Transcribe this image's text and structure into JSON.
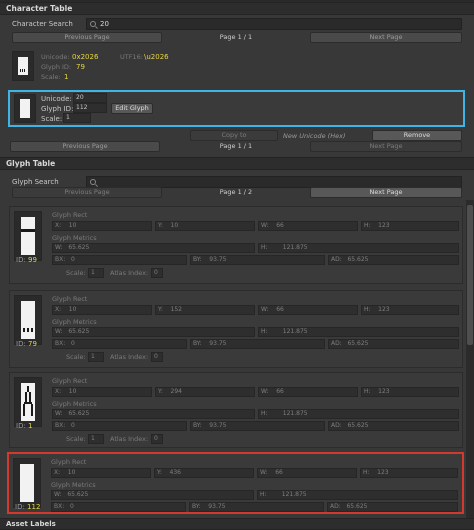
{
  "character_table": {
    "header": "Character Table",
    "search_label": "Character Search",
    "search_value": "20",
    "prev_label": "Previous Page",
    "next_label": "Next Page",
    "page_indicator": "Page 1 / 1",
    "item1": {
      "unicode_label": "Unicode:",
      "unicode_value": "0x2026",
      "utf16_label": "UTF16:",
      "utf16_value": "\\u2026",
      "glyph_id_label": "Glyph ID:",
      "glyph_id_value": "79",
      "scale_label": "Scale:",
      "scale_value": "1"
    },
    "item2": {
      "unicode_label": "Unicode:",
      "unicode_value": "20",
      "glyph_id_label": "Glyph ID:",
      "glyph_id_value": "112",
      "edit_glyph_label": "Edit Glyph",
      "scale_label": "Scale:",
      "scale_value": "1"
    },
    "copy_to_label": "Copy to",
    "new_unicode_label": "New Unicode (Hex)",
    "remove_label": "Remove",
    "page_indicator_2": "Page 1 / 1"
  },
  "glyph_table": {
    "header": "Glyph Table",
    "search_label": "Glyph Search",
    "prev_label": "Previous Page",
    "next_label": "Next Page",
    "page_indicator": "Page 1 / 2",
    "labels": {
      "glyph_rect": "Glyph Rect",
      "glyph_metrics": "Glyph Metrics",
      "x": "X:",
      "y": "Y:",
      "w": "W:",
      "h": "H:",
      "bx": "BX:",
      "by": "BY:",
      "ad": "AD:",
      "id": "ID:",
      "scale": "Scale:",
      "atlas_index": "Atlas Index:"
    },
    "records": [
      {
        "id": "99",
        "x": "10",
        "y": "10",
        "w": "66",
        "h": "123",
        "mw": "65.625",
        "mh": "121.875",
        "bx": "0",
        "by": "93.75",
        "ad": "65.625",
        "scale": "1",
        "atlas": "0"
      },
      {
        "id": "79",
        "x": "10",
        "y": "152",
        "w": "66",
        "h": "123",
        "mw": "65.625",
        "mh": "121.875",
        "bx": "0",
        "by": "93.75",
        "ad": "65.625",
        "scale": "1",
        "atlas": "0"
      },
      {
        "id": "1",
        "x": "10",
        "y": "294",
        "w": "66",
        "h": "123",
        "mw": "65.625",
        "mh": "121.875",
        "bx": "0",
        "by": "93.75",
        "ad": "65.625",
        "scale": "1",
        "atlas": "0"
      },
      {
        "id": "112",
        "x": "10",
        "y": "436",
        "w": "66",
        "h": "123",
        "mw": "65.625",
        "mh": "121.875",
        "bx": "0",
        "by": "93.75",
        "ad": "65.625",
        "scale": "1",
        "atlas": "0"
      }
    ]
  },
  "footer": {
    "asset_labels": "Asset Labels"
  },
  "colors": {
    "selected_cyan": "#3fb4e6",
    "selected_red": "#d23a2e",
    "value_yellow": "#e7d640"
  }
}
